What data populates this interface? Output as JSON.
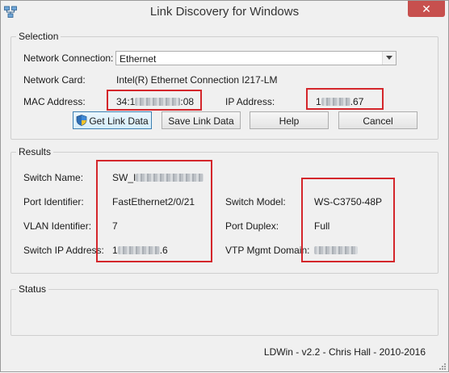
{
  "window": {
    "title": "Link Discovery for Windows",
    "close_glyph": "✕"
  },
  "selection": {
    "group_label": "Selection",
    "network_connection_label": "Network Connection:",
    "network_connection_value": "Ethernet",
    "network_card_label": "Network Card:",
    "network_card_value": "Intel(R) Ethernet Connection I217-LM",
    "mac_address_label": "MAC Address:",
    "mac_address_prefix": "34:1",
    "mac_address_suffix": ":08",
    "ip_address_label": "IP Address:",
    "ip_address_prefix": "1",
    "ip_address_suffix": ".67"
  },
  "buttons": {
    "get_link_data": "Get Link Data",
    "save_link_data": "Save Link Data",
    "help": "Help",
    "cancel": "Cancel"
  },
  "results": {
    "group_label": "Results",
    "switch_name_label": "Switch Name:",
    "switch_name_prefix": "SW_I",
    "port_identifier_label": "Port Identifier:",
    "port_identifier_value": "FastEthernet2/0/21",
    "vlan_identifier_label": "VLAN Identifier:",
    "vlan_identifier_value": "7",
    "switch_ip_label": "Switch IP Address:",
    "switch_ip_prefix": "1",
    "switch_ip_suffix": ".6",
    "switch_model_label": "Switch Model:",
    "switch_model_value": "WS-C3750-48P",
    "port_duplex_label": "Port Duplex:",
    "port_duplex_value": "Full",
    "vtp_domain_label": "VTP Mgmt Domain:"
  },
  "status": {
    "group_label": "Status"
  },
  "footer": {
    "text": "LDWin - v2.2 - Chris Hall - 2010-2016"
  },
  "icons": {
    "app": "network-computers-icon",
    "button": "uac-shield-icon"
  },
  "colors": {
    "highlight_box": "#d4262b",
    "close_button": "#c7504e"
  }
}
